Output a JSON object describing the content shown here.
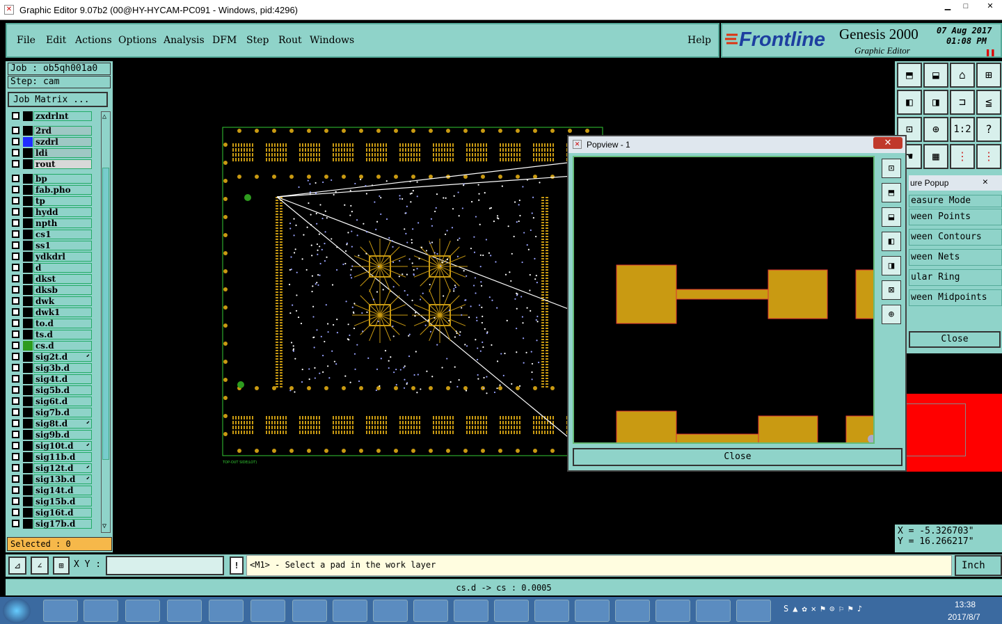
{
  "window": {
    "title": "Graphic Editor 9.07b2 (00@HY-HYCAM-PC091 - Windows, pid:4296)",
    "minimize": "▁",
    "maximize": "□",
    "close": "✕"
  },
  "menu": [
    "File",
    "Edit",
    "Actions",
    "Options",
    "Analysis",
    "DFM",
    "Step",
    "Rout",
    "Windows"
  ],
  "help": "Help",
  "brand": {
    "logo": "Frontline",
    "product": "Genesis 2000",
    "subtitle": "Graphic Editor",
    "date": "07 Aug 2017",
    "time": "01:08 PM"
  },
  "job": {
    "job_label": "Job : ob5qh001a0",
    "step_label": "Step: cam",
    "matrix_button": "Job Matrix ..."
  },
  "layers": [
    {
      "name": "zxdrlnt",
      "color": "#000000",
      "mark": ""
    },
    {
      "name": "2rd",
      "color": "#000000",
      "mark": ""
    },
    {
      "name": "szdrl",
      "color": "#1f2cff",
      "mark": ""
    },
    {
      "name": "ldi",
      "color": "#000000",
      "mark": ""
    },
    {
      "name": "rout",
      "color": "#000000",
      "mark": ""
    },
    {
      "name": "bp",
      "color": "#000000",
      "mark": ""
    },
    {
      "name": "fab.pho",
      "color": "#000000",
      "mark": ""
    },
    {
      "name": "tp",
      "color": "#000000",
      "mark": ""
    },
    {
      "name": "hydd",
      "color": "#000000",
      "mark": ""
    },
    {
      "name": "npth",
      "color": "#000000",
      "mark": ""
    },
    {
      "name": "cs1",
      "color": "#000000",
      "mark": ""
    },
    {
      "name": "ss1",
      "color": "#000000",
      "mark": ""
    },
    {
      "name": "ydkdrl",
      "color": "#000000",
      "mark": ""
    },
    {
      "name": "d",
      "color": "#000000",
      "mark": ""
    },
    {
      "name": "dkst",
      "color": "#000000",
      "mark": ""
    },
    {
      "name": "dksb",
      "color": "#000000",
      "mark": ""
    },
    {
      "name": "dwk",
      "color": "#000000",
      "mark": ""
    },
    {
      "name": "dwk1",
      "color": "#000000",
      "mark": ""
    },
    {
      "name": "to.d",
      "color": "#000000",
      "mark": ""
    },
    {
      "name": "ts.d",
      "color": "#000000",
      "mark": ""
    },
    {
      "name": "cs.d",
      "color": "#2e9b1e",
      "mark": ""
    },
    {
      "name": "sig2t.d",
      "color": "#000000",
      "mark": "⬋"
    },
    {
      "name": "sig3b.d",
      "color": "#000000",
      "mark": ""
    },
    {
      "name": "sig4t.d",
      "color": "#000000",
      "mark": ""
    },
    {
      "name": "sig5b.d",
      "color": "#000000",
      "mark": ""
    },
    {
      "name": "sig6t.d",
      "color": "#000000",
      "mark": ""
    },
    {
      "name": "sig7b.d",
      "color": "#000000",
      "mark": ""
    },
    {
      "name": "sig8t.d",
      "color": "#000000",
      "mark": "⬋"
    },
    {
      "name": "sig9b.d",
      "color": "#000000",
      "mark": ""
    },
    {
      "name": "sig10t.d",
      "color": "#000000",
      "mark": "⬋"
    },
    {
      "name": "sig11b.d",
      "color": "#000000",
      "mark": ""
    },
    {
      "name": "sig12t.d",
      "color": "#000000",
      "mark": "⬋"
    },
    {
      "name": "sig13b.d",
      "color": "#000000",
      "mark": "⬋"
    },
    {
      "name": "sig14t.d",
      "color": "#000000",
      "mark": ""
    },
    {
      "name": "sig15b.d",
      "color": "#000000",
      "mark": ""
    },
    {
      "name": "sig16t.d",
      "color": "#000000",
      "mark": ""
    },
    {
      "name": "sig17b.d",
      "color": "#000000",
      "mark": ""
    }
  ],
  "selected": "Selected : 0",
  "popview": {
    "title": "Popview - 1",
    "close": "Close"
  },
  "measure": {
    "title": "ure Popup",
    "items": [
      "easure Mode",
      "ween Points",
      "ween Contours",
      "ween Nets",
      "ular Ring",
      "ween Midpoints"
    ],
    "close": "Close"
  },
  "coords": {
    "x": "X = -5.326703\"",
    "y": "Y = 16.266217\""
  },
  "cmd": {
    "xy_label": "X Y :",
    "xy_value": "",
    "message": "<M1> - Select a pad in the work layer",
    "units": "Inch"
  },
  "status": "cs.d -> cs : 0.0005",
  "taskbar": {
    "time": "13:38",
    "date": "2017/8/7"
  },
  "board_label": "TOP-OUT SIDE(LOT)"
}
